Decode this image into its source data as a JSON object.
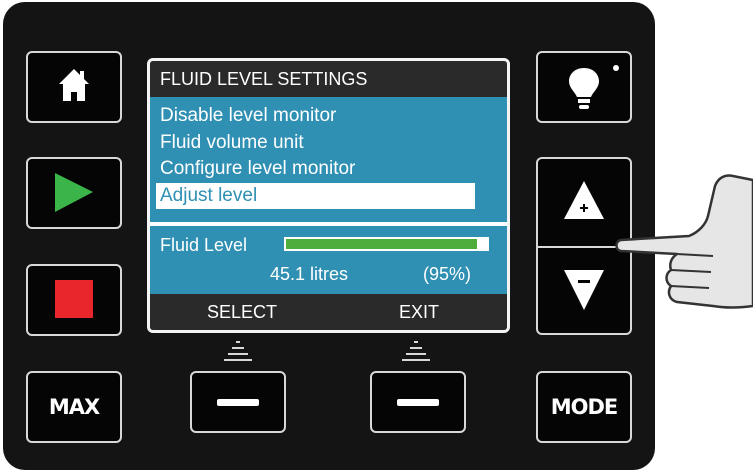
{
  "screen": {
    "title": "FLUID LEVEL SETTINGS",
    "menu": [
      {
        "label": "Disable level monitor",
        "selected": false
      },
      {
        "label": "Fluid volume unit",
        "selected": false
      },
      {
        "label": "Configure level monitor",
        "selected": false
      },
      {
        "label": "Adjust level",
        "selected": true
      }
    ],
    "fluid_level_label": "Fluid Level",
    "fluid_level_fraction": 0.95,
    "volume": "45.1 litres",
    "percent": "(95%)",
    "softkeys": {
      "left": "SELECT",
      "right": "EXIT"
    }
  },
  "buttons": {
    "home": {
      "icon": "home-icon"
    },
    "play": {
      "icon": "play-icon"
    },
    "stop": {
      "icon": "stop-icon"
    },
    "max": {
      "label": "MAX"
    },
    "softkey_left": {
      "icon": "minus-icon"
    },
    "softkey_right": {
      "icon": "minus-icon"
    },
    "light": {
      "icon": "lightbulb-icon"
    },
    "up": {
      "icon": "up-triangle-plus-icon"
    },
    "down": {
      "icon": "down-triangle-minus-icon"
    },
    "mode": {
      "label": "MODE"
    }
  },
  "colors": {
    "panel": "#141414",
    "screen_bg": "#2f90b3",
    "bar_fill": "#4fad3c",
    "play_green": "#3bb54a",
    "stop_red": "#e8262b"
  },
  "decorations": {
    "hand": "pointing-hand-icon"
  }
}
